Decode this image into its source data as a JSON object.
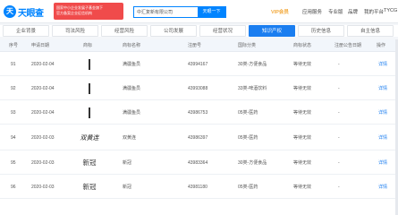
{
  "header": {
    "logo_mark": "天",
    "logo_text": "天眼查",
    "notice_line1": "国家中小企业发展子基金旗下",
    "notice_line2": "官方备案企业征信机构",
    "search_value": "中汇复新有限公司",
    "search_button": "天眼一下",
    "nav": {
      "vip": "VIP会员",
      "app": "应用服务",
      "pro": "专业版",
      "brand": "品牌",
      "reg": "我的平台",
      "user": "TYCG"
    }
  },
  "tabs": [
    {
      "label": "企业背景",
      "count": ""
    },
    {
      "label": "司法风险",
      "count": ""
    },
    {
      "label": "经营风险",
      "count": ""
    },
    {
      "label": "公司发展",
      "count": ""
    },
    {
      "label": "经营状况",
      "count": ""
    },
    {
      "label": "知识产权",
      "count": ""
    },
    {
      "label": "历史信息",
      "count": ""
    },
    {
      "label": "自主信息",
      "count": ""
    }
  ],
  "table": {
    "columns": [
      "序号",
      "申请日期",
      "商标",
      "商标名称",
      "注册号",
      "国际分类",
      "商标状态",
      "注册公告日期",
      "操作"
    ],
    "rows": [
      {
        "no": "91",
        "date": "2020-02-04",
        "name": "满疆鱼员",
        "reg": "43994167",
        "class": "30类-方便食品",
        "status": "等待无效",
        "pub": "-",
        "action": "详情"
      },
      {
        "no": "92",
        "date": "2020-02-04",
        "name": "满疆鱼员",
        "reg": "43993088",
        "class": "33类-啤酒饮料",
        "status": "等待无效",
        "pub": "-",
        "action": "详情"
      },
      {
        "no": "93",
        "date": "2020-02-04",
        "name": "满疆鱼员",
        "reg": "43986753",
        "class": "05类-医药",
        "status": "等待无效",
        "pub": "-",
        "action": "详情"
      },
      {
        "no": "94",
        "date": "2020-02-03",
        "name": "双黄连",
        "reg": "43986397",
        "class": "05类-医药",
        "status": "等待无效",
        "pub": "-",
        "action": "详情",
        "logo_text": "双黄连"
      },
      {
        "no": "95",
        "date": "2020-02-03",
        "name": "新冠",
        "reg": "43983364",
        "class": "30类-方便食品",
        "status": "等待无效",
        "pub": "-",
        "action": "详情",
        "logo_text": "新冠"
      },
      {
        "no": "96",
        "date": "2020-02-03",
        "name": "新冠",
        "reg": "43981180",
        "class": "05类-医药",
        "status": "等待无效",
        "pub": "-",
        "action": "详情",
        "logo_text": "新冠"
      }
    ]
  }
}
